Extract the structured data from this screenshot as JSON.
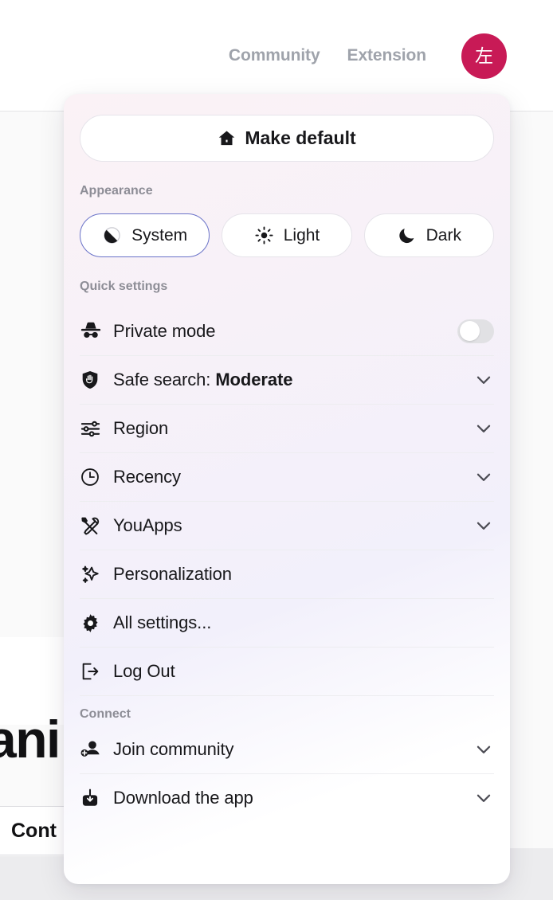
{
  "header": {
    "nav_links": [
      {
        "label": "Community",
        "name": "nav-link-community"
      },
      {
        "label": "Extension",
        "name": "nav-link-extension"
      }
    ],
    "avatar": {
      "initial": "左",
      "color": "#c81a56"
    }
  },
  "background": {
    "heading_fragment": "ani",
    "chip_fragment": "Cont"
  },
  "panel": {
    "make_default": {
      "label": "Make default",
      "icon": "home-icon"
    },
    "appearance": {
      "section_label": "Appearance",
      "options": [
        {
          "label": "System",
          "icon": "half-circle-icon",
          "selected": true
        },
        {
          "label": "Light",
          "icon": "sun-icon",
          "selected": false
        },
        {
          "label": "Dark",
          "icon": "moon-icon",
          "selected": false
        }
      ],
      "selected_value": "System",
      "selected_border_color": "#6a73c8"
    },
    "quick_settings": {
      "section_label": "Quick settings",
      "items": [
        {
          "label": "Private mode",
          "icon": "incognito-hat-icon",
          "control": "toggle",
          "toggle_on": false
        },
        {
          "label_prefix": "Safe search: ",
          "label_value": "Moderate",
          "icon": "shield-hand-icon",
          "control": "chevron"
        },
        {
          "label": "Region",
          "icon": "sliders-icon",
          "control": "chevron"
        },
        {
          "label": "Recency",
          "icon": "clock-icon",
          "control": "chevron"
        },
        {
          "label": "YouApps",
          "icon": "tools-icon",
          "control": "chevron"
        },
        {
          "label": "Personalization",
          "icon": "sparkles-icon",
          "control": "none"
        },
        {
          "label": "All settings...",
          "icon": "gear-icon",
          "control": "none"
        },
        {
          "label": "Log Out",
          "icon": "logout-icon",
          "control": "none"
        }
      ]
    },
    "connect": {
      "section_label": "Connect",
      "items": [
        {
          "label": "Join community",
          "icon": "user-plus-icon",
          "control": "chevron"
        },
        {
          "label": "Download the app",
          "icon": "download-icon",
          "control": "chevron"
        }
      ]
    }
  }
}
